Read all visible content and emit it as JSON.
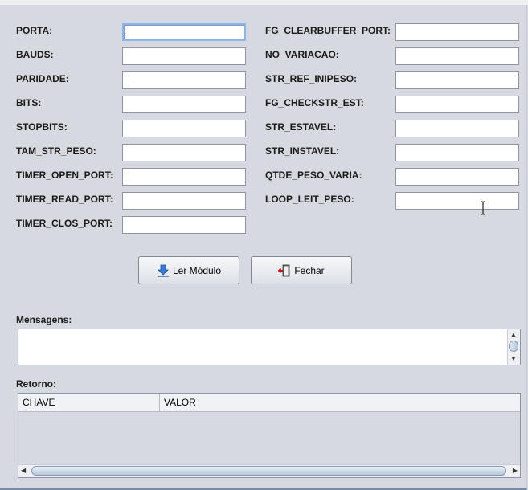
{
  "left_fields": [
    {
      "label": "PORTA:",
      "value": ""
    },
    {
      "label": "BAUDS:",
      "value": ""
    },
    {
      "label": "PARIDADE:",
      "value": ""
    },
    {
      "label": "BITS:",
      "value": ""
    },
    {
      "label": "STOPBITS:",
      "value": ""
    },
    {
      "label": "TAM_STR_PESO:",
      "value": ""
    },
    {
      "label": "TIMER_OPEN_PORT:",
      "value": ""
    },
    {
      "label": "TIMER_READ_PORT:",
      "value": ""
    },
    {
      "label": "TIMER_CLOS_PORT:",
      "value": ""
    }
  ],
  "right_fields": [
    {
      "label": "FG_CLEARBUFFER_PORT:",
      "value": ""
    },
    {
      "label": "NO_VARIACAO:",
      "value": ""
    },
    {
      "label": "STR_REF_INIPESO:",
      "value": ""
    },
    {
      "label": "FG_CHECKSTR_EST:",
      "value": ""
    },
    {
      "label": "STR_ESTAVEL:",
      "value": ""
    },
    {
      "label": "STR_INSTAVEL:",
      "value": ""
    },
    {
      "label": "QTDE_PESO_VARIA:",
      "value": ""
    },
    {
      "label": "LOOP_LEIT_PESO:",
      "value": ""
    }
  ],
  "buttons": {
    "read_label": "Ler Módulo",
    "read_icon": "download-arrow-icon",
    "close_label": "Fechar",
    "close_icon": "exit-door-icon"
  },
  "messages": {
    "label": "Mensagens:",
    "text": ""
  },
  "retorno": {
    "label": "Retorno:",
    "columns": [
      "CHAVE",
      "VALOR"
    ],
    "rows": []
  },
  "colors": {
    "panel_bg": "#d6d9df",
    "accent": "#2f6fc6"
  }
}
